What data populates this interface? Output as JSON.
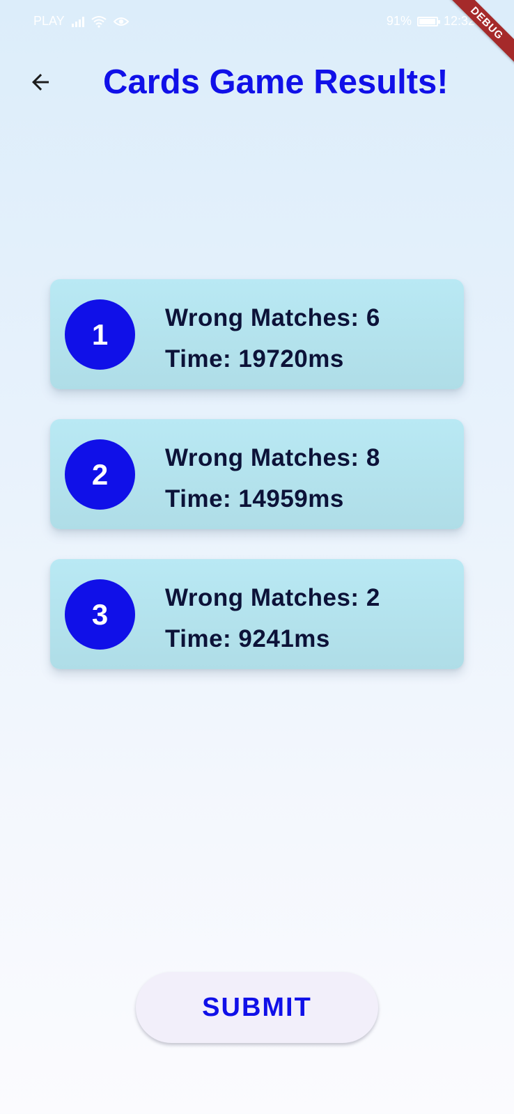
{
  "status_bar": {
    "carrier": "PLAY",
    "battery": "91%",
    "time": "12:32"
  },
  "debug_banner": "DEBUG",
  "app_bar": {
    "title": "Cards Game Results!",
    "back_icon": "arrow-back-icon"
  },
  "results": [
    {
      "rank": "1",
      "wrong_matches": "Wrong Matches: 6",
      "time": "Time: 19720ms"
    },
    {
      "rank": "2",
      "wrong_matches": "Wrong Matches: 8",
      "time": "Time: 14959ms"
    },
    {
      "rank": "3",
      "wrong_matches": "Wrong Matches: 2",
      "time": "Time: 9241ms"
    }
  ],
  "submit_label": "SUBMIT",
  "colors": {
    "accent": "#1010e8",
    "card_bg": "#b3e3ee",
    "card_text": "#0c1238"
  }
}
